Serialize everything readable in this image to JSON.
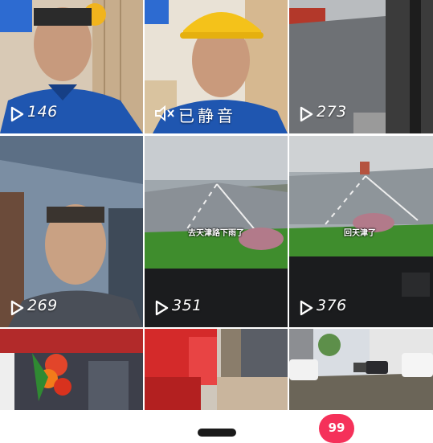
{
  "grid": {
    "tiles": [
      {
        "count": "146"
      },
      {
        "muted_label": "已静音"
      },
      {
        "count": "273"
      },
      {
        "count": "269"
      },
      {
        "count": "351",
        "subtitle": "去天津路下雨了"
      },
      {
        "count": "376",
        "subtitle": "回天津了"
      },
      {},
      {},
      {}
    ]
  },
  "bottom_nav": {
    "notification_badge": "99"
  },
  "colors": {
    "badge": "#f5315a",
    "overlay_text": "#ffffff"
  }
}
